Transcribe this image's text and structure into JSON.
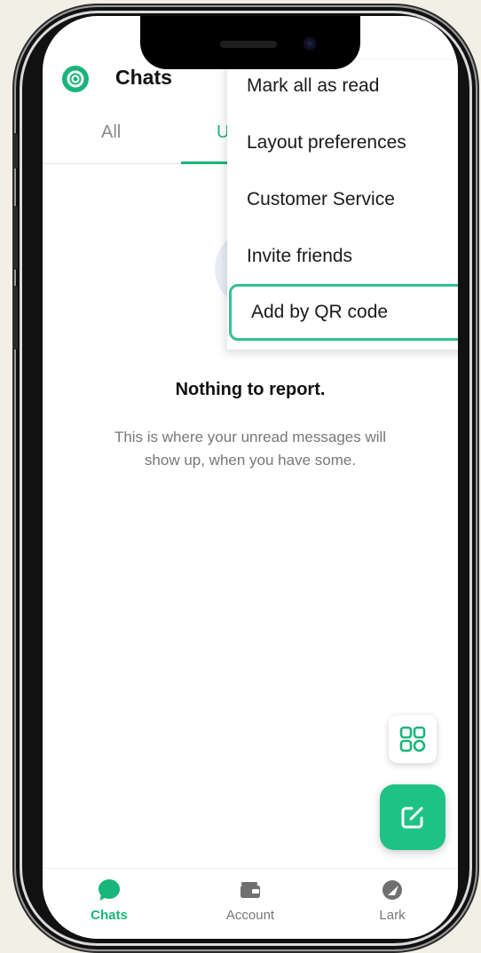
{
  "header": {
    "title": "Chats"
  },
  "tabs": [
    {
      "label": "All"
    },
    {
      "label": "U"
    }
  ],
  "menu": {
    "items": [
      {
        "label": "Mark all as read"
      },
      {
        "label": "Layout preferences"
      },
      {
        "label": "Customer Service"
      },
      {
        "label": "Invite friends"
      },
      {
        "label": "Add by QR code"
      }
    ]
  },
  "empty_state": {
    "title": "Nothing to report.",
    "description": "This is where your unread messages will show up, when you have some."
  },
  "bottom_nav": [
    {
      "label": "Chats",
      "icon": "chat-bubble-icon"
    },
    {
      "label": "Account",
      "icon": "wallet-icon"
    },
    {
      "label": "Lark",
      "icon": "lark-icon"
    }
  ],
  "colors": {
    "accent": "#19b57a",
    "highlight_border": "#35c08d"
  }
}
